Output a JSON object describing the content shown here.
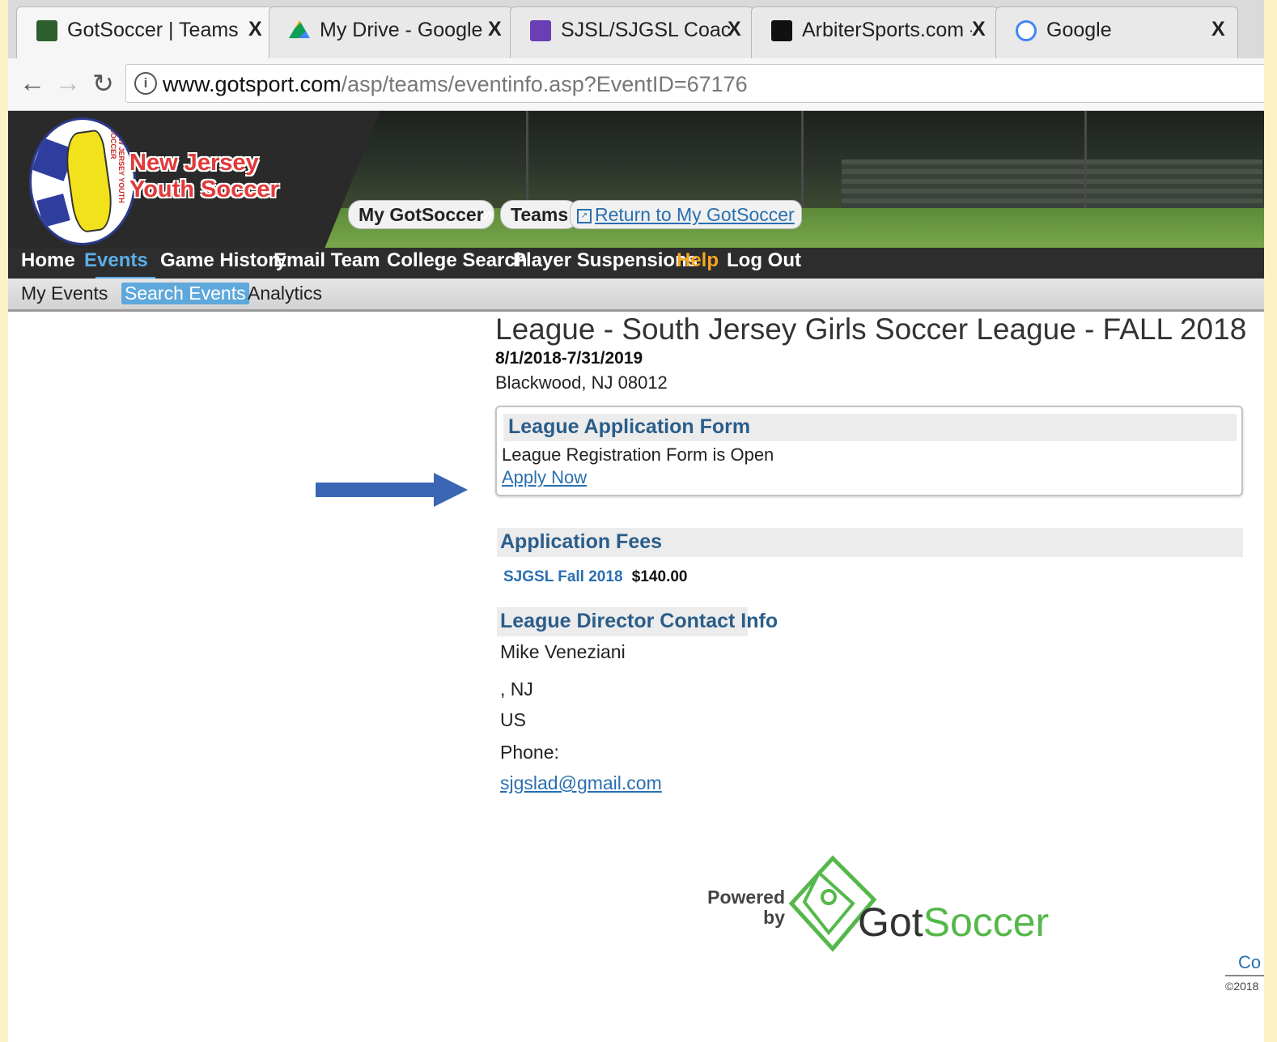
{
  "browser": {
    "tabs": [
      {
        "title": "GotSoccer | Teams | Event",
        "close": "X"
      },
      {
        "title": "My Drive - Google Drive",
        "close": "X"
      },
      {
        "title": "SJSL/SJGSL Coach Registr",
        "close": "X"
      },
      {
        "title": "ArbiterSports.com - Leag",
        "close": "X"
      },
      {
        "title": "Google",
        "close": "X"
      }
    ],
    "url_host": "www.gotsport.com",
    "url_path": "/asp/teams/eventinfo.asp?EventID=67176",
    "info_glyph": "i"
  },
  "header": {
    "logo_line1": "New Jersey",
    "logo_line2": "Youth Soccer",
    "logo_ring_text": "NEW JERSEY YOUTH SOCCER",
    "crumb_home": "My GotSoccer",
    "crumb_sep": "»",
    "crumb_current": "Teams",
    "return_link": "Return to My GotSoccer"
  },
  "main_nav": {
    "items": [
      "Home",
      "Events",
      "Game History",
      "Email Team",
      "College Search",
      "Player Suspensions",
      "Help",
      "Log Out"
    ]
  },
  "sub_nav": {
    "items": [
      "My Events",
      "Search Events",
      "Analytics"
    ]
  },
  "event": {
    "title": "League - South Jersey Girls Soccer League - FALL 2018",
    "dates": "8/1/2018-7/31/2019",
    "location": "Blackwood, NJ 08012"
  },
  "application": {
    "heading": "League Application Form",
    "status": "League Registration Form is Open",
    "apply_label": "Apply Now"
  },
  "fees": {
    "heading": "Application Fees",
    "items": [
      {
        "name": "SJGSL Fall 2018",
        "amount": "$140.00"
      }
    ]
  },
  "contact": {
    "heading": "League Director Contact Info",
    "name": "Mike Veneziani",
    "city_state": ", NJ",
    "country": "US",
    "phone_label": "Phone:",
    "email": "sjgslad@gmail.com"
  },
  "footer": {
    "powered_line1": "Powered",
    "powered_line2": "by",
    "brand_got": "Got",
    "brand_soccer": "Soccer",
    "link_partial": "Co",
    "copyright_partial": "©2018"
  },
  "colors": {
    "page_bg": "#fdf1c6",
    "accent_blue": "#5aaee8",
    "link_blue": "#2a6fb0",
    "help_orange": "#f5a623",
    "heading_blue": "#2a5d8a",
    "arrow_blue": "#3a66b4",
    "gotsoccer_green": "#55b84a"
  },
  "icons": {
    "back": "back-arrow-icon",
    "forward": "forward-arrow-icon",
    "reload": "reload-icon",
    "info": "info-icon",
    "arrow": "annotation-arrow-icon"
  }
}
